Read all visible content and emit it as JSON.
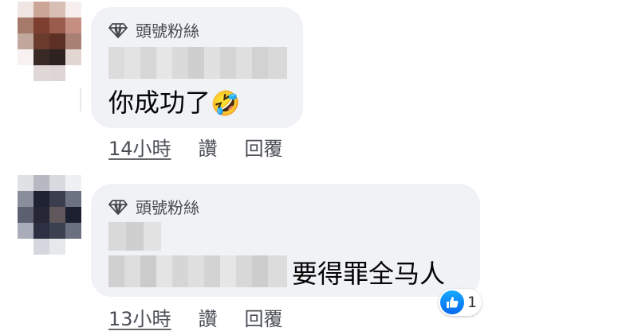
{
  "colors": {
    "bubble_bg": "#f0f2f5",
    "like_blue": "#1877f2"
  },
  "comments": [
    {
      "badge_icon": "diamond-icon",
      "badge_label": "頭號粉絲",
      "text": "你成功了",
      "emoji": "🤣",
      "emoji_name": "rolling-on-floor-laughing-emoji",
      "time": "14小時",
      "like_label": "讚",
      "reply_label": "回覆"
    },
    {
      "badge_icon": "diamond-icon",
      "badge_label": "頭號粉絲",
      "text": "要得罪全马人",
      "time": "13小時",
      "like_label": "讚",
      "reply_label": "回覆",
      "reaction_icon": "thumbs-up-icon",
      "reaction_count": "1"
    }
  ]
}
